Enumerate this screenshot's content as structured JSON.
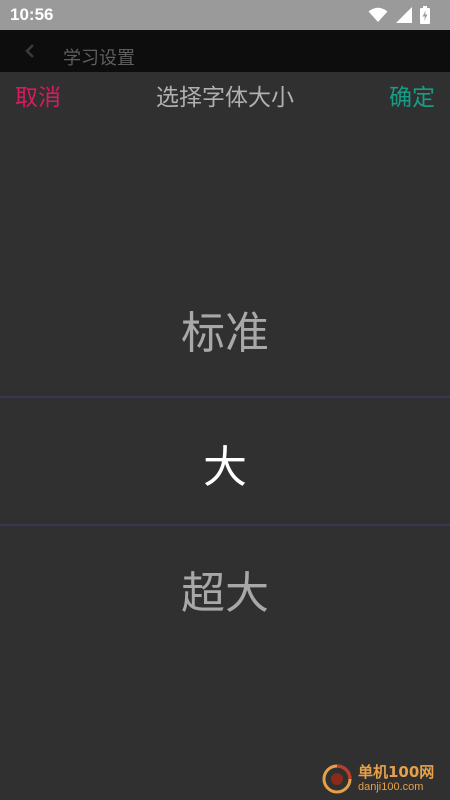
{
  "status_bar": {
    "time": "10:56",
    "icons": [
      "wifi-icon",
      "signal-icon",
      "battery-charging-icon"
    ]
  },
  "app_bar": {
    "title": "学习设置",
    "back_icon": "back-arrow-icon"
  },
  "dialog": {
    "cancel_label": "取消",
    "title": "选择字体大小",
    "confirm_label": "确定",
    "options": [
      "标准",
      "大",
      "超大"
    ],
    "selected": "大"
  },
  "watermark": {
    "text": "单机100网",
    "url": "danji100.com"
  },
  "colors": {
    "cancel": "#d81b60",
    "confirm": "#179c86",
    "background": "#303030",
    "divider": "#3a3550",
    "selected_text": "#ffffff",
    "unselected_text": "#a8a8a8"
  }
}
